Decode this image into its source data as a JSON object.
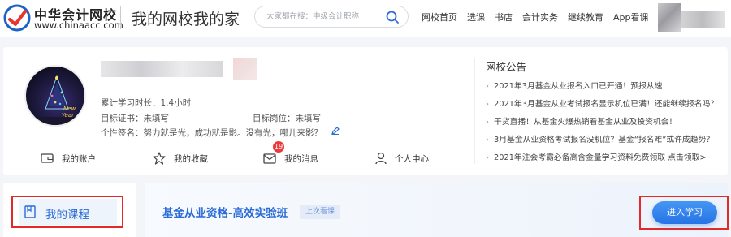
{
  "header": {
    "brand_cn": "中华会计网校",
    "brand_en": "www.chinaacc.com",
    "slogan": "我的网校我的家",
    "search_placeholder": "大家都在搜：中级会计职称",
    "nav": [
      "网校首页",
      "选课",
      "书店",
      "会计实务",
      "继续教育",
      "App看课"
    ]
  },
  "profile": {
    "study_time": "累计学习时长：1.4小时",
    "target_cert": "目标证书：未填写",
    "target_post": "目标岗位：未填写",
    "signature": "个性签名：努力就是光，成功就是影。没有光，哪儿来影？",
    "actions": [
      {
        "label": "我的账户",
        "icon": "wallet-icon"
      },
      {
        "label": "我的收藏",
        "icon": "star-icon"
      },
      {
        "label": "我的消息",
        "icon": "mail-icon",
        "badge": "19"
      },
      {
        "label": "个人中心",
        "icon": "user-icon"
      }
    ]
  },
  "notice": {
    "title": "网校公告",
    "items": [
      "2021年3月基金从业报名入口已开通！预报从速",
      "2021年3月基金从业考试报名显示机位已满！还能继续报名吗？",
      "干货直播！从基金火爆热销看基金从业及投资机会！",
      "3月基金从业资格考试报名没机位？基金“报名难”或许成趋势？",
      "2021年注会考霸必备高含金量学习资料免费领取 点击领取>"
    ]
  },
  "course": {
    "side_label": "我的课程",
    "title": "基金从业资格-高效实验班",
    "last_tag": "上次看课",
    "enter_label": "进入学习"
  },
  "colors": {
    "accent": "#2b6bd6",
    "highlight_border": "#e32a2a",
    "badge": "#e93b3b"
  }
}
